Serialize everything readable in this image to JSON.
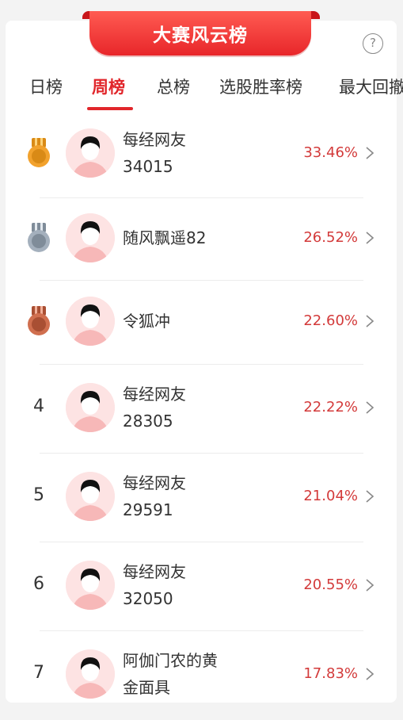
{
  "header": {
    "title": "大赛风云榜",
    "help_icon": "?"
  },
  "tabs": [
    {
      "label": "日榜",
      "active": false
    },
    {
      "label": "周榜",
      "active": true
    },
    {
      "label": "总榜",
      "active": false
    },
    {
      "label": "选股胜率榜",
      "active": false
    },
    {
      "label": "最大回撤",
      "active": false
    }
  ],
  "rankings": [
    {
      "rank": "1",
      "medal": "gold-medal-icon",
      "name": "每经网友\n34015",
      "pct": "33.46%"
    },
    {
      "rank": "2",
      "medal": "silver-medal-icon",
      "name": "随风飘遥82",
      "pct": "26.52%"
    },
    {
      "rank": "3",
      "medal": "bronze-medal-icon",
      "name": "令狐冲",
      "pct": "22.60%"
    },
    {
      "rank": "4",
      "medal": "",
      "name": "每经网友\n28305",
      "pct": "22.22%"
    },
    {
      "rank": "5",
      "medal": "",
      "name": "每经网友\n29591",
      "pct": "21.04%"
    },
    {
      "rank": "6",
      "medal": "",
      "name": "每经网友\n32050",
      "pct": "20.55%"
    },
    {
      "rank": "7",
      "medal": "",
      "name": "阿伽门农的黄\n金面具",
      "pct": "17.83%"
    }
  ],
  "colors": {
    "accent": "#e1262b",
    "percent": "#d33a3a",
    "gold": "#e8a52a",
    "silver": "#9aa6b3",
    "bronze": "#c8674a",
    "avatar_bg": "#fde3e3"
  }
}
